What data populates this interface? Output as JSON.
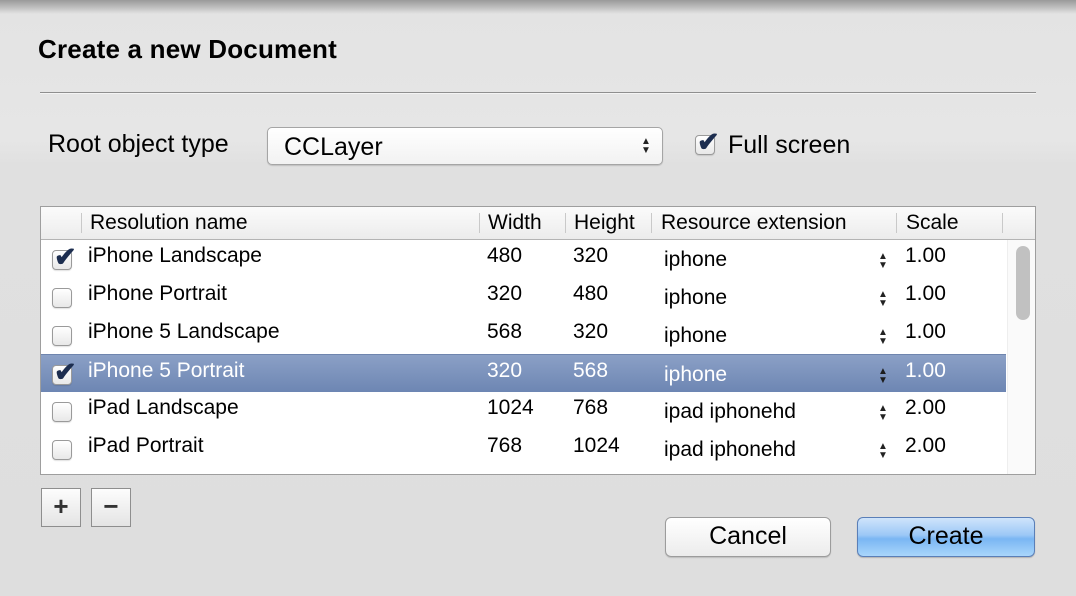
{
  "dialog": {
    "title": "Create a new Document",
    "root_label": "Root object type",
    "root_value": "CCLayer",
    "fullscreen_label": "Full screen",
    "fullscreen_checked": true
  },
  "table": {
    "headers": {
      "name": "Resolution name",
      "width": "Width",
      "height": "Height",
      "ext": "Resource extension",
      "scale": "Scale"
    },
    "rows": [
      {
        "checked": true,
        "name": "iPhone Landscape",
        "width": "480",
        "height": "320",
        "ext": "iphone",
        "scale": "1.00"
      },
      {
        "checked": false,
        "name": "iPhone Portrait",
        "width": "320",
        "height": "480",
        "ext": "iphone",
        "scale": "1.00"
      },
      {
        "checked": false,
        "name": "iPhone 5 Landscape",
        "width": "568",
        "height": "320",
        "ext": "iphone",
        "scale": "1.00"
      },
      {
        "checked": true,
        "name": "iPhone 5 Portrait",
        "width": "320",
        "height": "568",
        "ext": "iphone",
        "scale": "1.00"
      },
      {
        "checked": false,
        "name": "iPad Landscape",
        "width": "1024",
        "height": "768",
        "ext": "ipad iphonehd",
        "scale": "2.00"
      },
      {
        "checked": false,
        "name": "iPad Portrait",
        "width": "768",
        "height": "1024",
        "ext": "ipad iphonehd",
        "scale": "2.00"
      }
    ],
    "selected_row": 3
  },
  "buttons": {
    "add": "+",
    "remove": "−",
    "cancel": "Cancel",
    "create": "Create"
  },
  "icons": {
    "checkmark": "✔",
    "updown": "▲▼"
  }
}
